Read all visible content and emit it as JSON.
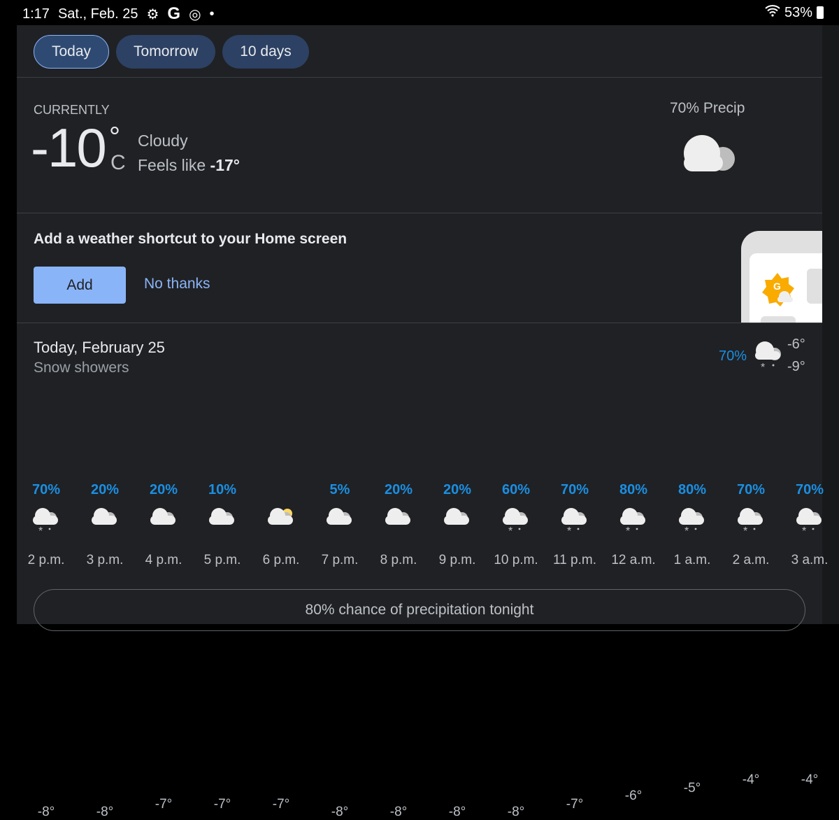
{
  "status": {
    "time": "1:17",
    "date": "Sat., Feb. 25",
    "battery": "53%",
    "icons": [
      "gear-icon",
      "google-icon",
      "target-icon",
      "dot-icon",
      "wifi-icon",
      "battery-icon"
    ]
  },
  "tabs": [
    {
      "label": "Today",
      "active": true
    },
    {
      "label": "Tomorrow"
    },
    {
      "label": "10 days"
    }
  ],
  "current": {
    "label": "CURRENTLY",
    "temp": "-10",
    "deg": "°",
    "unit": "C",
    "condition": "Cloudy",
    "feels_prefix": "Feels like ",
    "feels_value": "-17°",
    "precip": "70% Precip",
    "icon": "cloudy-icon"
  },
  "shortcut": {
    "title": "Add a weather shortcut to your Home screen",
    "add": "Add",
    "no_thanks": "No thanks"
  },
  "day": {
    "title": "Today, February 25",
    "subtitle": "Snow showers",
    "precip": "70%",
    "high": "-6°",
    "low": "-9°",
    "icon": "snow-showers-icon"
  },
  "hourly": [
    {
      "time": "2 p.m.",
      "temp": -8,
      "temp_label": "-8°",
      "precip": "70%",
      "icon": "snow"
    },
    {
      "time": "3 p.m.",
      "temp": -8,
      "temp_label": "-8°",
      "precip": "20%",
      "icon": "cloud"
    },
    {
      "time": "4 p.m.",
      "temp": -7,
      "temp_label": "-7°",
      "precip": "20%",
      "icon": "cloud"
    },
    {
      "time": "5 p.m.",
      "temp": -7,
      "temp_label": "-7°",
      "precip": "10%",
      "icon": "cloud"
    },
    {
      "time": "6 p.m.",
      "temp": -7,
      "temp_label": "-7°",
      "precip": "",
      "icon": "partly-cloudy"
    },
    {
      "time": "7 p.m.",
      "temp": -8,
      "temp_label": "-8°",
      "precip": "5%",
      "icon": "cloud"
    },
    {
      "time": "8 p.m.",
      "temp": -8,
      "temp_label": "-8°",
      "precip": "20%",
      "icon": "cloud"
    },
    {
      "time": "9 p.m.",
      "temp": -8,
      "temp_label": "-8°",
      "precip": "20%",
      "icon": "cloud"
    },
    {
      "time": "10 p.m.",
      "temp": -8,
      "temp_label": "-8°",
      "precip": "60%",
      "icon": "snow"
    },
    {
      "time": "11 p.m.",
      "temp": -7,
      "temp_label": "-7°",
      "precip": "70%",
      "icon": "snow"
    },
    {
      "time": "12 a.m.",
      "temp": -6,
      "temp_label": "-6°",
      "precip": "80%",
      "icon": "snow"
    },
    {
      "time": "1 a.m.",
      "temp": -5,
      "temp_label": "-5°",
      "precip": "80%",
      "icon": "snow"
    },
    {
      "time": "2 a.m.",
      "temp": -4,
      "temp_label": "-4°",
      "precip": "70%",
      "icon": "snow"
    },
    {
      "time": "3 a.m.",
      "temp": -4,
      "temp_label": "-4°",
      "precip": "70%",
      "icon": "snow"
    }
  ],
  "colors": {
    "accent": "#8ab4f8",
    "precip": "#1a8fe3",
    "line": "#1a73c8",
    "panel": "#202124"
  },
  "tonight": "80% chance of precipitation tonight"
}
